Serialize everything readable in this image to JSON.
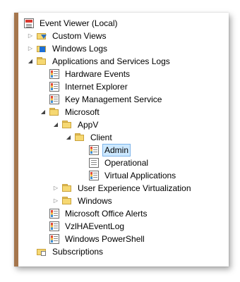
{
  "tree": {
    "root": {
      "label": "Event Viewer (Local)",
      "icon": "event-viewer-icon"
    },
    "custom_views": {
      "label": "Custom Views",
      "icon": "custom-views-icon",
      "expander": "collapsed"
    },
    "windows_logs": {
      "label": "Windows Logs",
      "icon": "windows-logs-icon",
      "expander": "collapsed"
    },
    "apps_services": {
      "label": "Applications and Services Logs",
      "icon": "log-folder-icon",
      "expander": "expanded"
    },
    "hardware_events": {
      "label": "Hardware Events",
      "icon": "event-log-icon"
    },
    "internet_explorer": {
      "label": "Internet Explorer",
      "icon": "event-log-icon"
    },
    "key_mgmt": {
      "label": "Key Management Service",
      "icon": "event-log-icon"
    },
    "microsoft": {
      "label": "Microsoft",
      "icon": "folder-icon",
      "expander": "expanded"
    },
    "appv": {
      "label": "AppV",
      "icon": "folder-icon",
      "expander": "expanded"
    },
    "client": {
      "label": "Client",
      "icon": "folder-icon",
      "expander": "expanded"
    },
    "admin": {
      "label": "Admin",
      "icon": "event-log-icon",
      "selected": true
    },
    "operational": {
      "label": "Operational",
      "icon": "log-icon"
    },
    "virtual_apps": {
      "label": "Virtual Applications",
      "icon": "event-log-icon"
    },
    "uev": {
      "label": "User Experience Virtualization",
      "icon": "folder-icon",
      "expander": "collapsed"
    },
    "windows": {
      "label": "Windows",
      "icon": "folder-icon",
      "expander": "collapsed"
    },
    "office_alerts": {
      "label": "Microsoft Office Alerts",
      "icon": "event-log-icon"
    },
    "vzlha": {
      "label": "VzlHAEventLog",
      "icon": "event-log-icon"
    },
    "powershell": {
      "label": "Windows PowerShell",
      "icon": "event-log-icon"
    },
    "subscriptions": {
      "label": "Subscriptions",
      "icon": "subscriptions-icon"
    }
  },
  "colors": {
    "selection_bg": "#cce8ff",
    "selection_border": "#7eb4ea",
    "frame_border": "#a5764d"
  }
}
